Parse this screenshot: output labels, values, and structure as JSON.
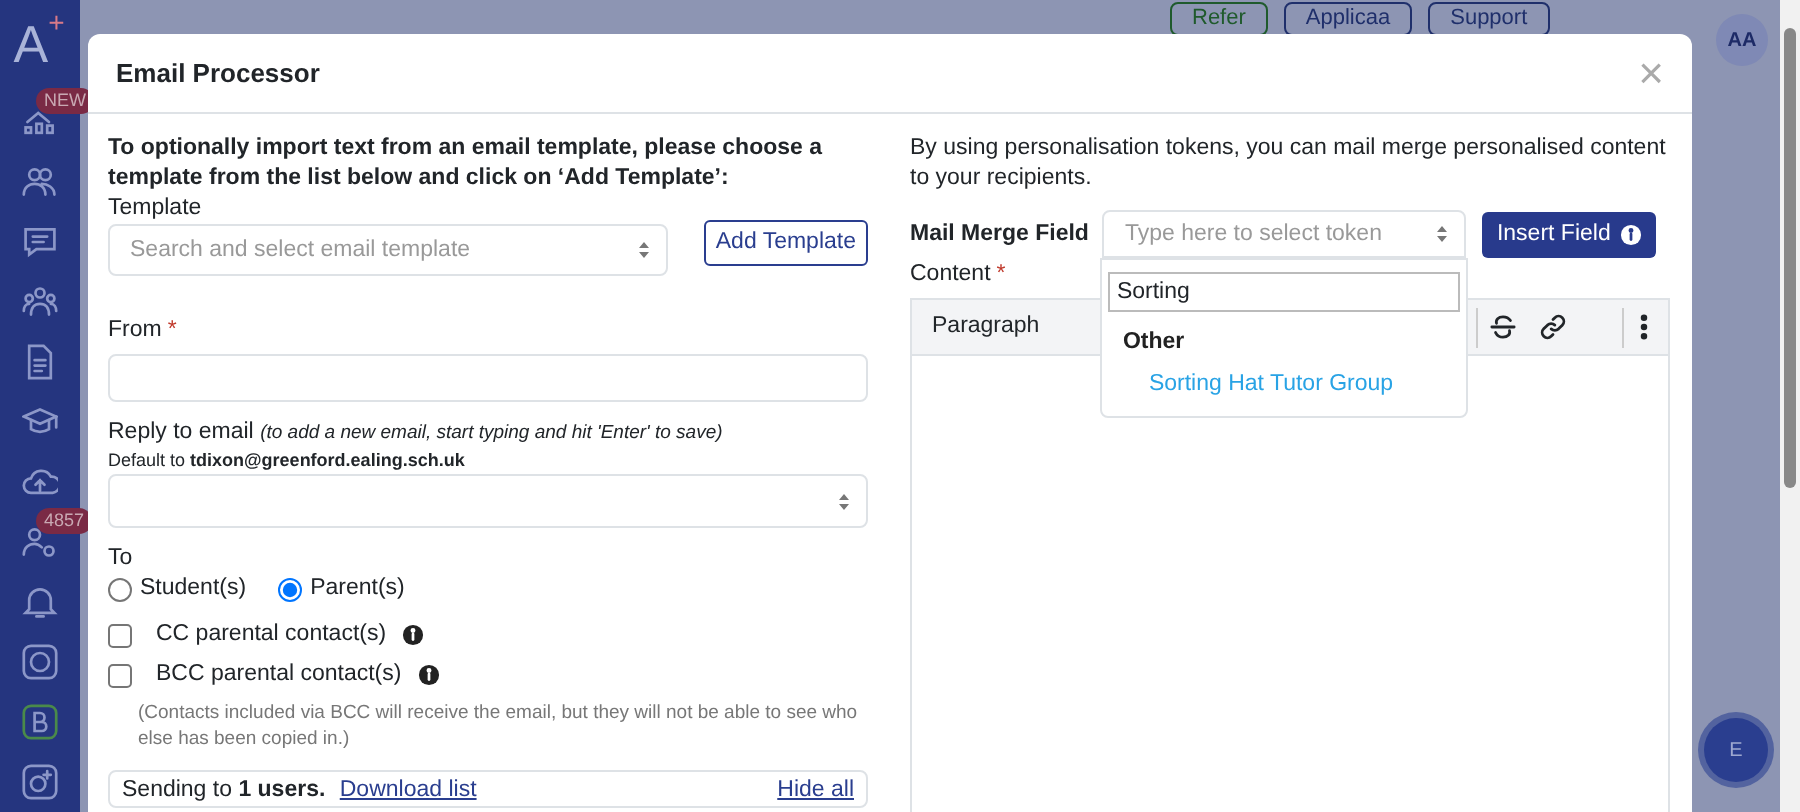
{
  "sidebar": {
    "logo": "A",
    "logo_mark": "+",
    "items": [
      {
        "kind": "chart",
        "badge": "NEW"
      },
      {
        "kind": "users"
      },
      {
        "kind": "chat"
      },
      {
        "kind": "group"
      },
      {
        "kind": "document"
      },
      {
        "kind": "cap"
      },
      {
        "kind": "cloud"
      },
      {
        "kind": "user-gear",
        "badge": "4857"
      },
      {
        "kind": "bell"
      },
      {
        "kind": "ring-app"
      },
      {
        "kind": "b-app"
      },
      {
        "kind": "o-app"
      }
    ]
  },
  "topbar": {
    "buttons": [
      "Refer",
      "Applicaa",
      "Support"
    ],
    "avatar": "AA"
  },
  "floating_button": "E",
  "modal": {
    "title": "Email Processor",
    "close": "×",
    "left": {
      "intro": "To optionally import text from an email template, please choose a template from the list below and click on ‘Add Template’:",
      "template": {
        "label": "Template",
        "placeholder": "Search and select email template",
        "button": "Add Template"
      },
      "from": {
        "label": "From",
        "required_mark": "*"
      },
      "reply": {
        "label": "Reply to email *(to add a new email, start typing and hit 'Enter' to save)*",
        "default": "Default to **tdixon@greenford.ealing.sch.uk**"
      },
      "to": {
        "label": "To",
        "options": [
          {
            "label": "Student(s)",
            "selected": false
          },
          {
            "label": "Parent(s)",
            "selected": true
          }
        ]
      },
      "contacts": [
        {
          "label": "CC parental contact(s)",
          "checked": false
        },
        {
          "label": "BCC parental contact(s)",
          "checked": false
        }
      ],
      "bcc_note": "(Contacts included via BCC will receive the email, but they will not be able to see who else has been copied in.)",
      "sending": {
        "text": "Sending to **1 users.**",
        "link": "Download list",
        "hide": "Hide all"
      }
    },
    "right": {
      "intro": "By using personalisation tokens, you can mail merge personalised content to your recipients.",
      "merge_label": "Mail Merge Field",
      "merge_placeholder": "Type here to select token",
      "insert_button": "Insert Field",
      "content": {
        "label": "Content",
        "required_mark": "*"
      },
      "editor": {
        "paragraph": "Paragraph"
      },
      "dropdown": {
        "search": "Sorting",
        "group": "Other",
        "options": [
          "Sorting Hat Tutor Group"
        ]
      }
    }
  }
}
